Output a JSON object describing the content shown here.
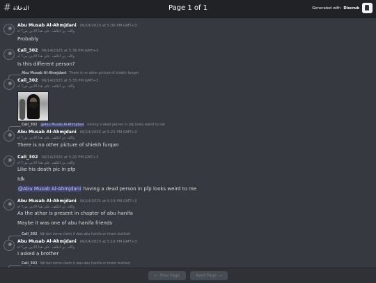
{
  "header": {
    "channel_icon": "#",
    "channel_name": "الدخلاة",
    "page_title": "Page 1 of 1",
    "generated_prefix": "Generated with",
    "generated_brand": "Discrub"
  },
  "messages": [
    {
      "author": "Abu Musab Al-Ahmjdani",
      "timestamp": "06/14/2025 at 5:36 PM GMT+3",
      "sub": "والله، بي اتكلف. على هذا الادين من؟ اه",
      "text": "Probably"
    },
    {
      "author": "Cali_302",
      "timestamp": "06/14/2025 at 5:36 PM GMT+3",
      "sub": "والله، بي اتكلف. على هذا الادين من؟ اه",
      "text": "Is this different person?"
    },
    {
      "reply_author": "Abu Musab Al-Ahmjdani",
      "reply_text": "There is no other picture of shiekh furqan",
      "author": "Cali_302",
      "timestamp": "06/14/2025 at 5:35 PM GMT+3",
      "sub": "والله، بي اتكلف. على هذا الادين من؟ اه"
    },
    {
      "reply_author": "Cali_302",
      "reply_mention": "@Abu Musab Al-Ahmjdani",
      "reply_text": "having a dead person in pfp looks weird to me",
      "author": "Abu Musab Al-Ahmjdani",
      "timestamp": "06/14/2025 at 5:21 PM GMT+3",
      "sub": "والله، بي اتكلف. على هذا الادين من؟ اه",
      "text": "There is no other picture of shiekh furqan"
    },
    {
      "author": "Cali_302",
      "timestamp": "06/14/2025 at 5:20 PM GMT+3",
      "sub": "والله، بي اتكلف. على هذا الادين من؟ اه",
      "text": "Like his death pic in pfp",
      "text2": "Idk",
      "text3_mention": "@Abu Musab Al-Ahmjdani",
      "text3": "having a dead person in pfp looks weird to me"
    },
    {
      "author": "Abu Musab Al-Ahmjdani",
      "timestamp": "06/14/2025 at 5:19 PM GMT+3",
      "sub": "والله، بي اتكلف. على هذا الادين من؟ اه",
      "text": "As the athar is present in chapter of abu hanifa",
      "text2": "Maybe it was one of abu hanifa friends"
    },
    {
      "reply_author": "Cali_302",
      "reply_text": "Idk but some claim it was abu hanifa or imam bukhari",
      "author": "Abu Musab Al-Ahmjdani",
      "timestamp": "06/14/2025 at 5:18 PM GMT+3",
      "sub": "والله، بي اتكلف. على هذا الادين من؟ اه",
      "text": "I asked a brother"
    },
    {
      "reply_author": "Cali_302",
      "reply_text": "Idk but some claim it was abu hanifa or imam bukhari"
    }
  ],
  "footer": {
    "prev_label": "Prev Page",
    "next_label": "Next Page",
    "prev_arrow": "←",
    "next_arrow": "→"
  }
}
